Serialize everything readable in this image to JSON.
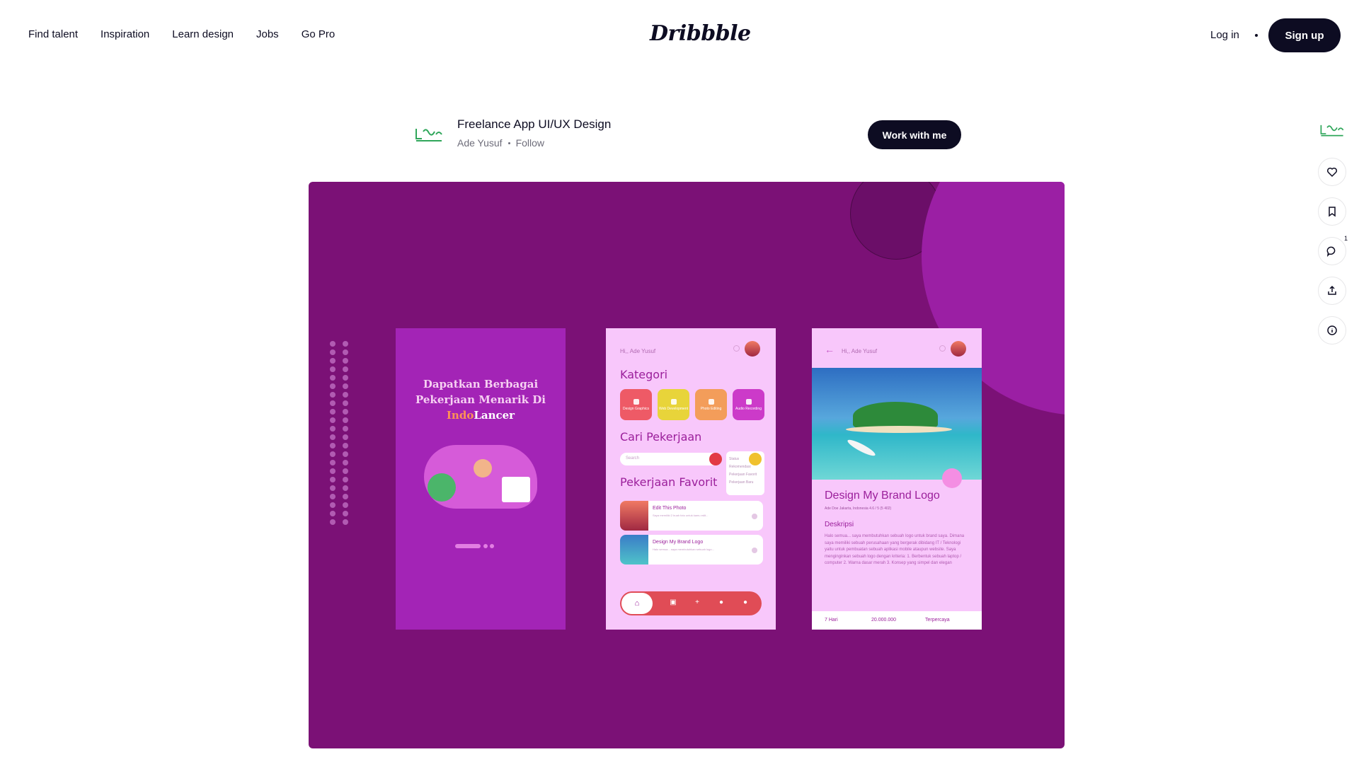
{
  "nav": {
    "links": [
      "Find talent",
      "Inspiration",
      "Learn design",
      "Jobs",
      "Go Pro"
    ],
    "logo": "Dribbble",
    "login": "Log in",
    "signup": "Sign up"
  },
  "shot": {
    "title": "Freelance App UI/UX Design",
    "author": "Ade Yusuf",
    "follow": "Follow",
    "cta": "Work with me",
    "comment_count": "1"
  },
  "colors": {
    "brand_dark": "#0d0c22",
    "shot_bg": "#7b1176",
    "accent_purple": "#9b1fa4"
  },
  "icons": [
    "heart-icon",
    "bookmark-icon",
    "comment-icon",
    "share-icon",
    "info-icon"
  ],
  "mockup": {
    "phone1": {
      "title_line1": "Dapatkan Berbagai",
      "title_line2": "Pekerjaan Menarik Di",
      "brand_a": "Indo",
      "brand_b": "Lancer"
    },
    "phone2": {
      "greeting": "Hi,, Ade Yusuf",
      "kategori": "Kategori",
      "categories": [
        "Design Graphics",
        "Web Development",
        "Photo Editing",
        "Audio Recording"
      ],
      "cari": "Cari Pekerjaan",
      "search_placeholder": "Search",
      "dropdown": [
        "Status",
        "Rekomendasi",
        "Pekerjaan Favorit",
        "Pekerjaan Baru"
      ],
      "favorit": "Pekerjaan Favorit",
      "jobs": [
        {
          "title": "Edit This Photo",
          "sub": "Saya memiliki 2 buah foto untuk kamu edit..."
        },
        {
          "title": "Design My Brand Logo",
          "sub": "Halo semua... saya membutuhkan sebuah logo..."
        }
      ]
    },
    "phone3": {
      "greeting": "Hi,, Ade Yusuf",
      "title": "Design My Brand Logo",
      "meta": "Ade Doe   Jakarta, Indonesia   4.6 / 5 (5 402)",
      "sub": "Deskripsi",
      "desc": "Halo semua... saya membutuhkan sebuah logo untuk brand saya. Dimana saya memiliki sebuah perusahaan yang bergerak dibidang IT / Teknologi yaitu untuk pembuatan sebuah aplikasi mobile ataupun website. Saya menginginkan sebuah logo dengan kriteria: 1. Berbentuk sebuah laptop / computer 2. Warna dasar merah 3. Konsep yang simpel dan elegan",
      "footer": [
        "7 Hari",
        "20.000.000",
        "Terpercaya"
      ]
    }
  }
}
